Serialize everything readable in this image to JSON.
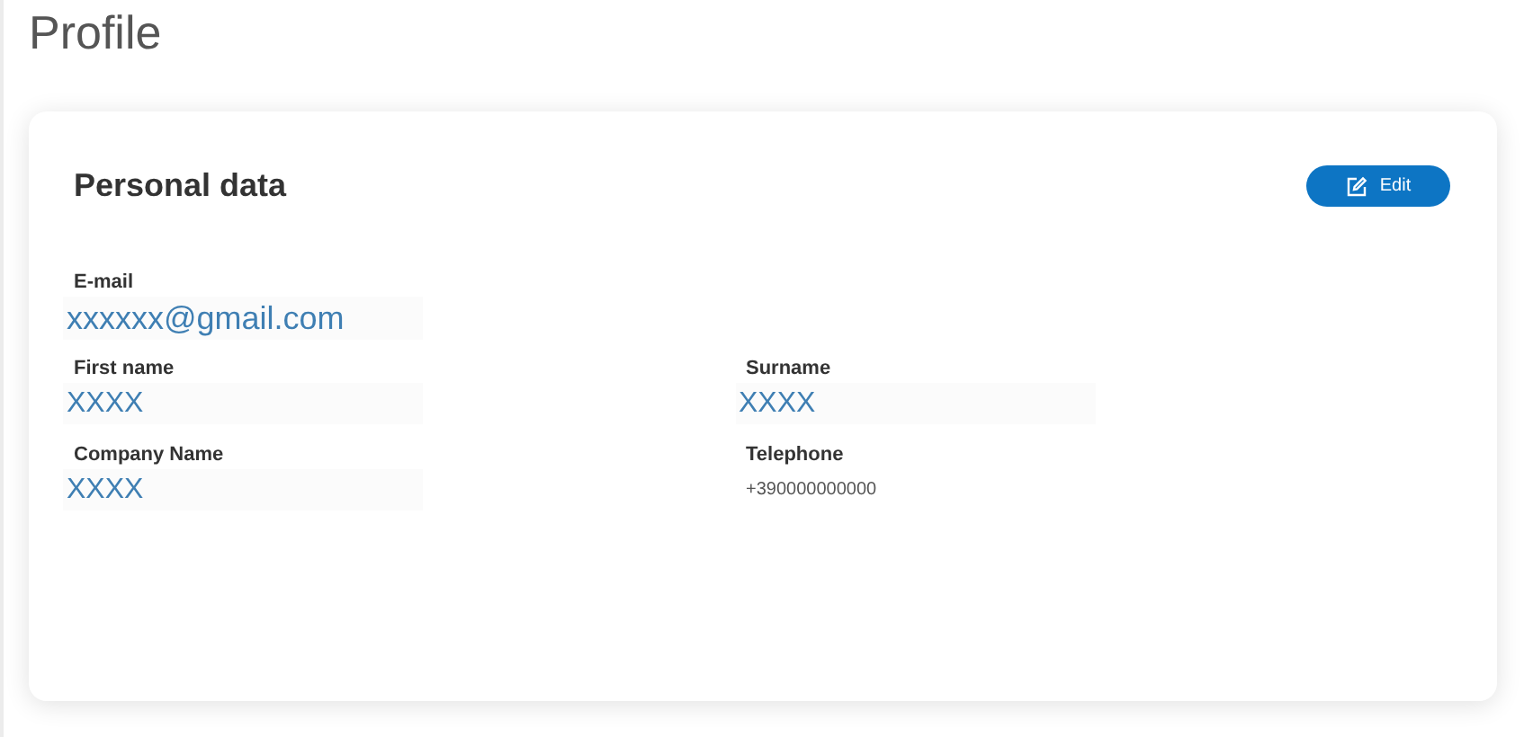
{
  "page": {
    "title": "Profile"
  },
  "card": {
    "title": "Personal data",
    "edit_button": "Edit"
  },
  "fields": [
    {
      "label": "E-mail",
      "value": "xxxxxx@gmail.com",
      "kind": "large"
    },
    {
      "label": "First name",
      "value": "XXXX",
      "kind": "box"
    },
    {
      "label": "Surname",
      "value": "XXXX",
      "kind": "box"
    },
    {
      "label": "Company Name",
      "value": "XXXX",
      "kind": "box"
    },
    {
      "label": "Telephone",
      "value": "+390000000000",
      "kind": "plain"
    }
  ]
}
